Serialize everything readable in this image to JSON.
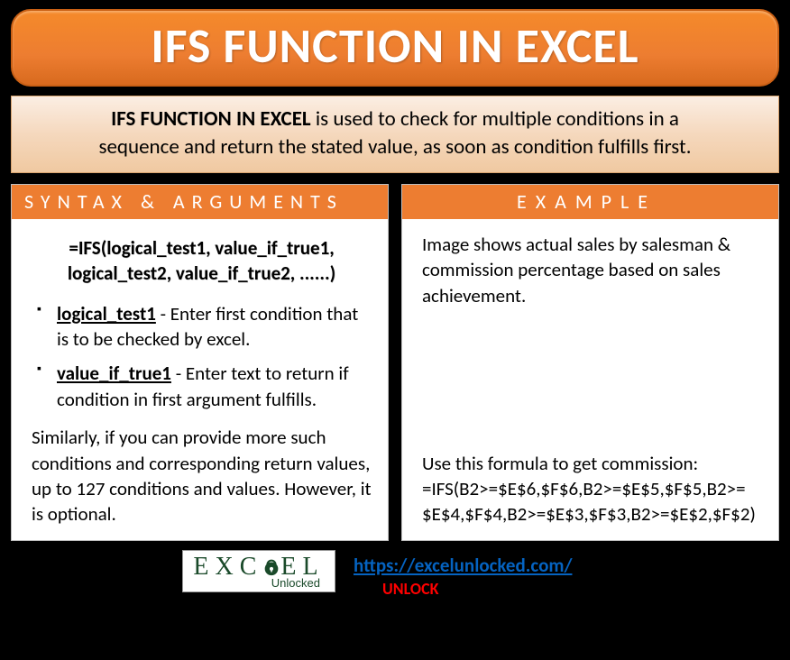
{
  "title": "IFS FUNCTION IN EXCEL",
  "description": {
    "lead": "IFS FUNCTION IN EXCEL",
    "rest1": " is used to check for multiple conditions in a",
    "rest2": "sequence and return the stated value, as soon as condition fulfills first."
  },
  "left": {
    "header": "SYNTAX & ARGUMENTS",
    "syntax1": "=IFS(logical_test1, value_if_true1,",
    "syntax2": "logical_test2, value_if_true2, ......)",
    "args": [
      {
        "name": "logical_test1",
        "desc": " - Enter first condition that is to be checked by excel."
      },
      {
        "name": "value_if_true1",
        "desc": " - Enter text to return if condition in first argument fulfills."
      }
    ],
    "note": "Similarly, if you can provide more such conditions and corresponding return values, up to 127 conditions and values. However, it is optional."
  },
  "right": {
    "header": "EXAMPLE",
    "intro": "Image shows actual sales by salesman & commission percentage based on sales achievement.",
    "formula_label": "Use this formula to get commission:",
    "formula": "=IFS(B2>=$E$6,$F$6,B2>=$E$5,$F$5,B2>=$E$4,$F$4,B2>=$E$3,$F$3,B2>=$E$2,$F$2)"
  },
  "footer": {
    "logo_text_pre": "EX",
    "logo_text_mid": "C",
    "logo_text_post": "EL",
    "logo_sub": "Unlocked",
    "link": "https://excelunlocked.com/",
    "unlock": "UNLOCK"
  }
}
